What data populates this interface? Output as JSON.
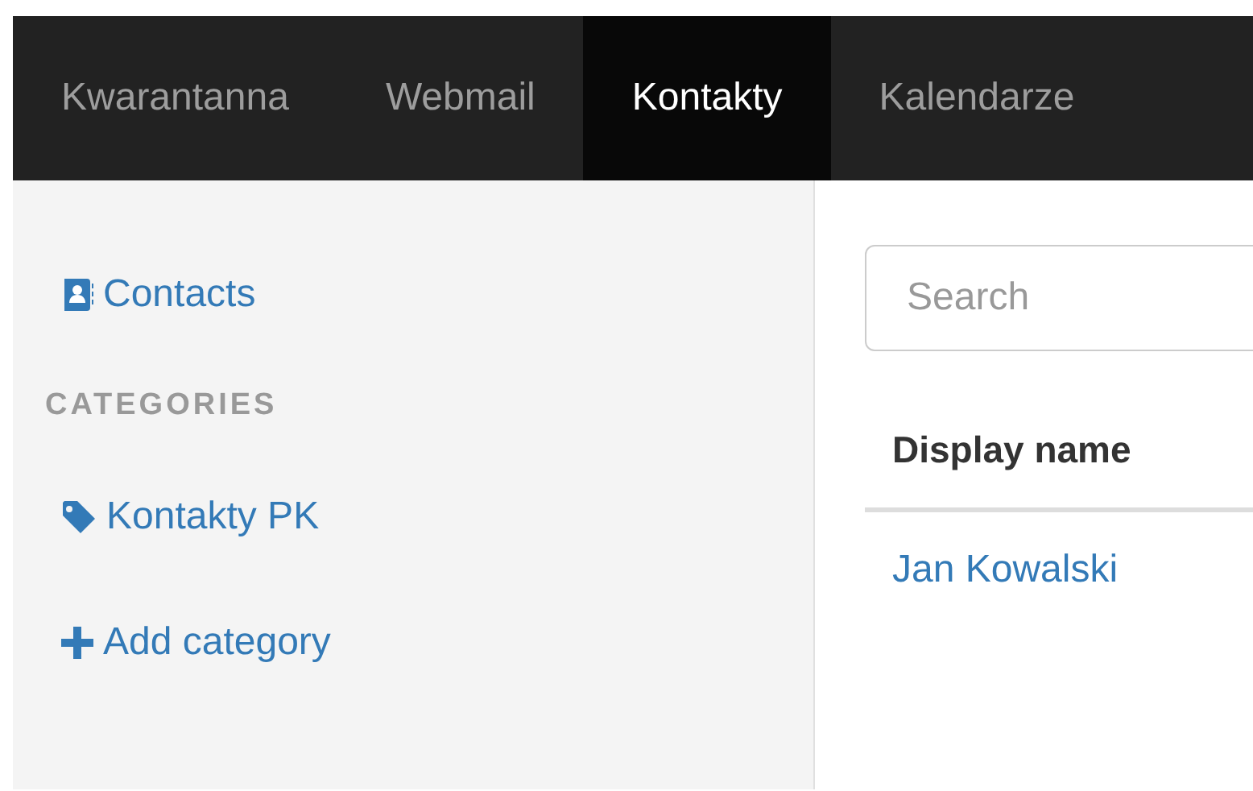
{
  "nav": {
    "tabs": [
      {
        "label": "Kwarantanna",
        "selected": false
      },
      {
        "label": "Webmail",
        "selected": false
      },
      {
        "label": "Kontakty",
        "selected": true
      },
      {
        "label": "Kalendarze",
        "selected": false
      }
    ]
  },
  "sidebar": {
    "contacts_link": "Contacts",
    "categories_heading": "CATEGORIES",
    "categories": [
      {
        "label": "Kontakty PK"
      }
    ],
    "add_category": "Add category"
  },
  "main": {
    "search": {
      "placeholder": "Search"
    },
    "table": {
      "columns": [
        "Display name"
      ],
      "rows": [
        [
          "Jan Kowalski"
        ]
      ]
    }
  }
}
